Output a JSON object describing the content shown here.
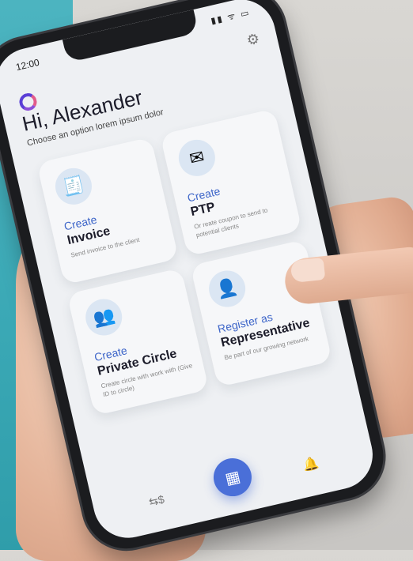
{
  "status": {
    "time": "12:00",
    "icons": "▮▮ ᯤ ▭"
  },
  "header": {
    "greeting": "Hi, Alexander",
    "subtitle": "Choose an option lorem ipsum dolor"
  },
  "cards": [
    {
      "verb": "Create",
      "name": "Invoice",
      "desc": "Send invoice to the client",
      "icon": "receipt-icon",
      "glyph": "🧾"
    },
    {
      "verb": "Create",
      "name": "PTP",
      "desc": "Or reate coupon to send to potential clients",
      "icon": "envelope-money-icon",
      "glyph": "✉"
    },
    {
      "verb": "Create",
      "name": "Private Circle",
      "desc": "Create circle with work with (Give ID to circle)",
      "icon": "people-network-icon",
      "glyph": "👥"
    },
    {
      "verb": "Register as",
      "name": "Representative",
      "desc": "Be part of our growing network",
      "icon": "user-circle-icon",
      "glyph": "👤"
    }
  ],
  "nav": {
    "left_icon": "money-transfer-icon",
    "left_glyph": "⇆$",
    "center_icon": "grid-icon",
    "center_glyph": "▦",
    "right_icon": "bell-icon",
    "right_glyph": "🔔"
  },
  "colors": {
    "accent": "#4a6fd8",
    "teal": "#3aa8b5",
    "text": "#1c1c2a"
  }
}
